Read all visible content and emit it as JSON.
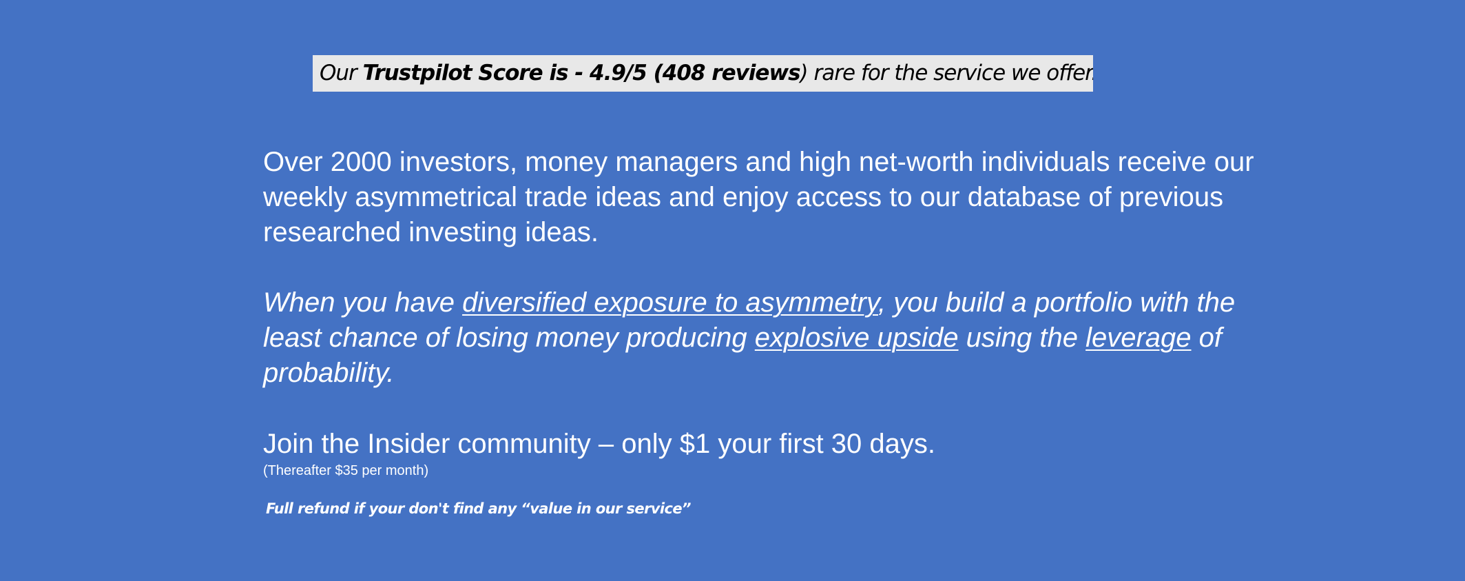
{
  "colors": {
    "background": "#4472c4",
    "trust_box_background": "#e8e8e8",
    "trust_text": "#000000",
    "body_text": "#ffffff"
  },
  "trustpilot": {
    "prefix": "Our ",
    "bold": "Trustpilot Score  is - 4.9/5 (408 reviews",
    "suffix": ") rare for the service we offer."
  },
  "intro": {
    "text": "Over 2000 investors, money managers and high net-worth individuals receive our weekly asymmetrical trade ideas and enjoy access to our database of previous researched investing ideas."
  },
  "pitch": {
    "part1": "When you have ",
    "link1": "diversified exposure to asymmetry",
    "part2": ", you build a portfolio with the least chance of losing money producing ",
    "link2": "explosive upside",
    "part3": " using the ",
    "link3": "leverage",
    "part4": " of probability."
  },
  "offer": {
    "headline": "Join the Insider community – only $1 your first 30 days.",
    "subtext": "(Thereafter $35 per month)",
    "refund": "Full refund if your don't find any “value in our service”"
  }
}
